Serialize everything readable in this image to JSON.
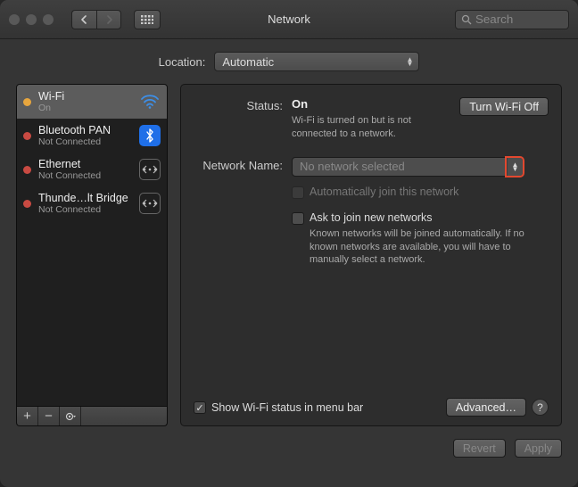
{
  "window": {
    "title": "Network"
  },
  "toolbar": {
    "search_placeholder": "Search"
  },
  "location": {
    "label": "Location:",
    "value": "Automatic"
  },
  "sidebar": {
    "items": [
      {
        "name": "Wi-Fi",
        "status": "On",
        "dot": "yellow",
        "icon": "wifi"
      },
      {
        "name": "Bluetooth PAN",
        "status": "Not Connected",
        "dot": "red",
        "icon": "bluetooth"
      },
      {
        "name": "Ethernet",
        "status": "Not Connected",
        "dot": "red",
        "icon": "ethernet"
      },
      {
        "name": "Thunde…lt Bridge",
        "status": "Not Connected",
        "dot": "red",
        "icon": "thunderbolt"
      }
    ]
  },
  "detail": {
    "status_label": "Status:",
    "status_value": "On",
    "turn_off_label": "Turn Wi-Fi Off",
    "status_sub": "Wi-Fi is turned on but is not connected to a network.",
    "network_name_label": "Network Name:",
    "network_name_value": "No network selected",
    "auto_join_label": "Automatically join this network",
    "ask_join_label": "Ask to join new networks",
    "ask_join_sub": "Known networks will be joined automatically. If no known networks are available, you will have to manually select a network.",
    "show_menu_label": "Show Wi-Fi status in menu bar",
    "advanced_label": "Advanced…"
  },
  "footer": {
    "revert_label": "Revert",
    "apply_label": "Apply"
  }
}
